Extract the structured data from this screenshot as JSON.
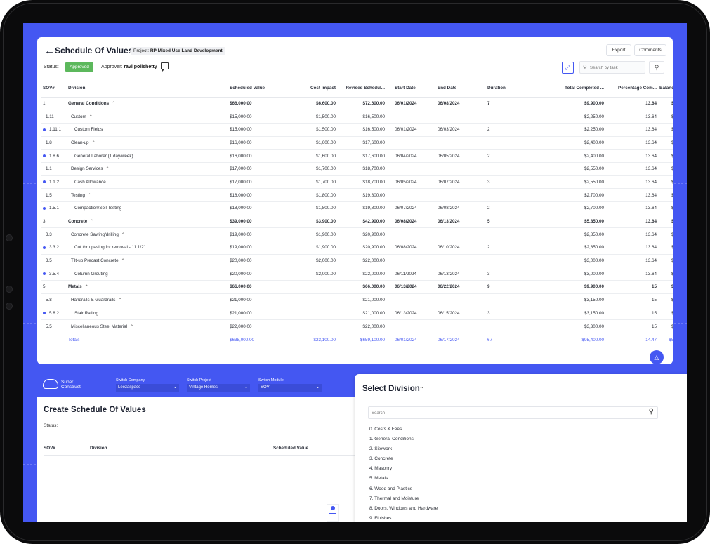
{
  "header": {
    "back_icon": "arrow-left-icon",
    "title": "Schedule Of Values",
    "project_label": "Project:",
    "project_name": "RP Mixed Use Land Development",
    "export_label": "Export",
    "comments_label": "Comments",
    "status_label": "Status:",
    "status_value": "Approved",
    "approver_label": "Approver:",
    "approver_name": "ravi polishetty",
    "search_placeholder": "Search by task"
  },
  "colors": {
    "accent": "#4457f2",
    "approved": "#5cb85c"
  },
  "table": {
    "columns": [
      "SOV#",
      "Division",
      "Scheduled Value",
      "Cost Impact",
      "Revised Schedul...",
      "Start Date",
      "End Date",
      "Duration",
      "Total Completed ...",
      "Percentage Com...",
      "Balance"
    ],
    "rows": [
      {
        "sov": "1",
        "division": "General Conditions",
        "scheduled": "$66,000.00",
        "cost_impact": "$6,600.00",
        "revised": "$72,600.00",
        "start": "06/01/2024",
        "end": "06/08/2024",
        "duration": "7",
        "completed": "$9,900.00",
        "pct": "13.64",
        "balance": "$6",
        "kind": "group"
      },
      {
        "sov": "1.11",
        "division": "Custom",
        "scheduled": "$15,000.00",
        "cost_impact": "$1,500.00",
        "revised": "$16,500.00",
        "start": "",
        "end": "",
        "duration": "",
        "completed": "$2,250.00",
        "pct": "13.64",
        "balance": "$1",
        "kind": "sub"
      },
      {
        "sov": "1.11.1",
        "division": "Custom Fields",
        "scheduled": "$15,000.00",
        "cost_impact": "$1,500.00",
        "revised": "$16,500.00",
        "start": "06/01/2024",
        "end": "06/03/2024",
        "duration": "2",
        "completed": "$2,250.00",
        "pct": "13.64",
        "balance": "$1",
        "kind": "leaf"
      },
      {
        "sov": "1.8",
        "division": "Clean-up",
        "scheduled": "$16,000.00",
        "cost_impact": "$1,600.00",
        "revised": "$17,600.00",
        "start": "",
        "end": "",
        "duration": "",
        "completed": "$2,400.00",
        "pct": "13.64",
        "balance": "$1",
        "kind": "sub"
      },
      {
        "sov": "1.8.6",
        "division": "General Laborer (1 day/week)",
        "scheduled": "$16,000.00",
        "cost_impact": "$1,600.00",
        "revised": "$17,600.00",
        "start": "06/04/2024",
        "end": "06/05/2024",
        "duration": "2",
        "completed": "$2,400.00",
        "pct": "13.64",
        "balance": "$1",
        "kind": "leaf"
      },
      {
        "sov": "1.1",
        "division": "Design Services",
        "scheduled": "$17,000.00",
        "cost_impact": "$1,700.00",
        "revised": "$18,700.00",
        "start": "",
        "end": "",
        "duration": "",
        "completed": "$2,550.00",
        "pct": "13.64",
        "balance": "$1",
        "kind": "sub"
      },
      {
        "sov": "1.1.2",
        "division": "Cash Allowance",
        "scheduled": "$17,000.00",
        "cost_impact": "$1,700.00",
        "revised": "$18,700.00",
        "start": "06/05/2024",
        "end": "06/07/2024",
        "duration": "3",
        "completed": "$2,550.00",
        "pct": "13.64",
        "balance": "$1",
        "kind": "leaf"
      },
      {
        "sov": "1.5",
        "division": "Testing",
        "scheduled": "$18,000.00",
        "cost_impact": "$1,800.00",
        "revised": "$19,800.00",
        "start": "",
        "end": "",
        "duration": "",
        "completed": "$2,700.00",
        "pct": "13.64",
        "balance": "$1",
        "kind": "sub"
      },
      {
        "sov": "1.5.1",
        "division": "Compaction/Soil Testing",
        "scheduled": "$18,000.00",
        "cost_impact": "$1,800.00",
        "revised": "$19,800.00",
        "start": "06/07/2024",
        "end": "06/08/2024",
        "duration": "2",
        "completed": "$2,700.00",
        "pct": "13.64",
        "balance": "$1",
        "kind": "leaf"
      },
      {
        "sov": "3",
        "division": "Concrete",
        "scheduled": "$39,000.00",
        "cost_impact": "$3,900.00",
        "revised": "$42,900.00",
        "start": "06/08/2024",
        "end": "06/13/2024",
        "duration": "5",
        "completed": "$5,850.00",
        "pct": "13.64",
        "balance": "$3",
        "kind": "group"
      },
      {
        "sov": "3.3",
        "division": "Concrete Sawing/drilling",
        "scheduled": "$19,000.00",
        "cost_impact": "$1,900.00",
        "revised": "$20,900.00",
        "start": "",
        "end": "",
        "duration": "",
        "completed": "$2,850.00",
        "pct": "13.64",
        "balance": "$1",
        "kind": "sub"
      },
      {
        "sov": "3.3.2",
        "division": "Cut thru paving for removal - 11 1/2\"",
        "scheduled": "$19,000.00",
        "cost_impact": "$1,900.00",
        "revised": "$20,900.00",
        "start": "06/08/2024",
        "end": "06/10/2024",
        "duration": "2",
        "completed": "$2,850.00",
        "pct": "13.64",
        "balance": "$1",
        "kind": "leaf"
      },
      {
        "sov": "3.5",
        "division": "Tilt-up Precast Concrete",
        "scheduled": "$20,000.00",
        "cost_impact": "$2,000.00",
        "revised": "$22,000.00",
        "start": "",
        "end": "",
        "duration": "",
        "completed": "$3,000.00",
        "pct": "13.64",
        "balance": "$1",
        "kind": "sub"
      },
      {
        "sov": "3.5.4",
        "division": "Column Grouting",
        "scheduled": "$20,000.00",
        "cost_impact": "$2,000.00",
        "revised": "$22,000.00",
        "start": "06/11/2024",
        "end": "06/13/2024",
        "duration": "3",
        "completed": "$3,000.00",
        "pct": "13.64",
        "balance": "$1",
        "kind": "leaf"
      },
      {
        "sov": "5",
        "division": "Metals",
        "scheduled": "$66,000.00",
        "cost_impact": "",
        "revised": "$66,000.00",
        "start": "06/13/2024",
        "end": "06/22/2024",
        "duration": "9",
        "completed": "$9,900.00",
        "pct": "15",
        "balance": "$5",
        "kind": "group"
      },
      {
        "sov": "5.8",
        "division": "Handrails & Guardrails",
        "scheduled": "$21,000.00",
        "cost_impact": "",
        "revised": "$21,000.00",
        "start": "",
        "end": "",
        "duration": "",
        "completed": "$3,150.00",
        "pct": "15",
        "balance": "$1",
        "kind": "sub"
      },
      {
        "sov": "5.8.2",
        "division": "Stair Railing",
        "scheduled": "$21,000.00",
        "cost_impact": "",
        "revised": "$21,000.00",
        "start": "06/13/2024",
        "end": "06/15/2024",
        "duration": "3",
        "completed": "$3,150.00",
        "pct": "15",
        "balance": "$1",
        "kind": "leaf"
      },
      {
        "sov": "5.5",
        "division": "Miscellaneous Steel Material",
        "scheduled": "$22,000.00",
        "cost_impact": "",
        "revised": "$22,000.00",
        "start": "",
        "end": "",
        "duration": "",
        "completed": "$3,300.00",
        "pct": "15",
        "balance": "$1",
        "kind": "sub"
      }
    ],
    "totals": {
      "label": "Totals",
      "scheduled": "$638,000.00",
      "cost_impact": "$23,100.00",
      "revised": "$659,100.00",
      "start": "06/01/2024",
      "end": "06/17/2024",
      "duration": "67",
      "completed": "$95,400.00",
      "pct": "14.47",
      "balance": "$56"
    }
  },
  "app_bar": {
    "brand_line1": "Super",
    "brand_line2": "Construct",
    "switch_company_label": "Switch Company",
    "switch_company_value": "Leezaspace",
    "switch_project_label": "Switch Project",
    "switch_project_value": "Vintage Homes",
    "switch_module_label": "Switch Module",
    "switch_module_value": "SOV"
  },
  "create_sov": {
    "title": "Create Schedule Of Values",
    "status_label": "Status:",
    "col_sov": "SOV#",
    "col_division": "Division",
    "col_scheduled": "Scheduled Value"
  },
  "select_division": {
    "title": "Select Division",
    "search_placeholder": "Search",
    "items": [
      "0. Costs & Fees",
      "1. General Conditions",
      "2. Sitework",
      "3. Concrete",
      "4. Masonry",
      "5. Metals",
      "6. Wood and Plastics",
      "7. Thermal and Moisture",
      "8. Doors, Windows and Hardware",
      "9. Finishes"
    ]
  }
}
